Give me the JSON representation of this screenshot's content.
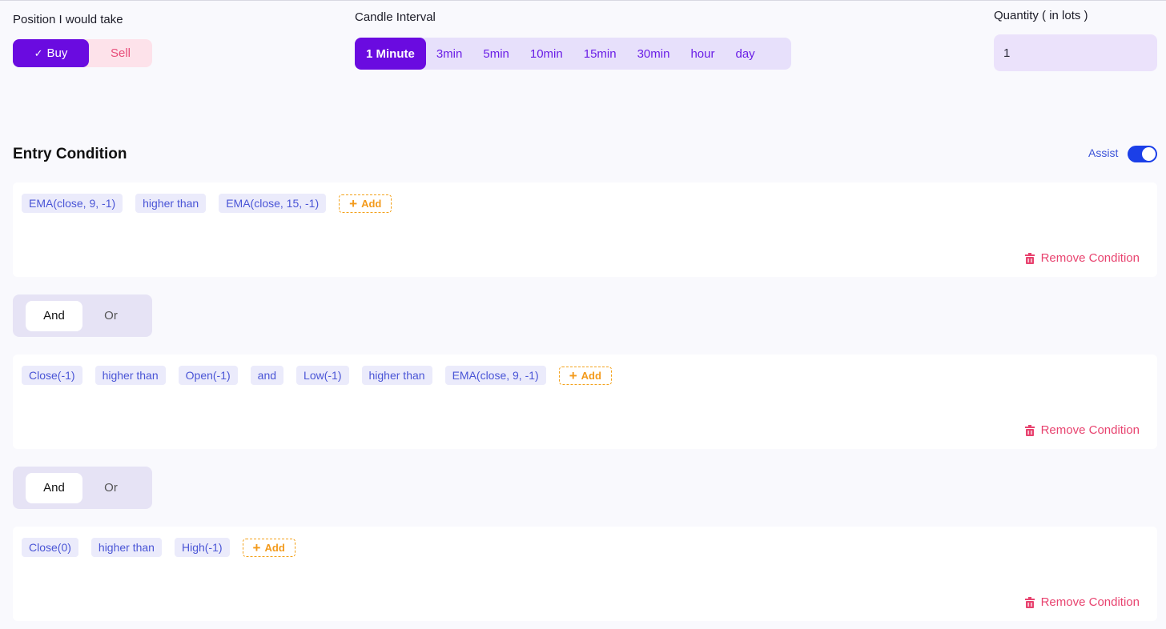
{
  "position": {
    "label": "Position I would take",
    "buy_label": "Buy",
    "sell_label": "Sell",
    "selected": "Buy"
  },
  "candle_interval": {
    "label": "Candle Interval",
    "options": [
      "1 Minute",
      "3min",
      "5min",
      "10min",
      "15min",
      "30min",
      "hour",
      "day"
    ],
    "selected": "1 Minute"
  },
  "quantity": {
    "label": "Quantity ( in lots )",
    "value": "1"
  },
  "entry_condition": {
    "title": "Entry Condition",
    "assist_label": "Assist",
    "assist_on": true,
    "add_label": "Add",
    "remove_label": "Remove Condition",
    "and_label": "And",
    "or_label": "Or",
    "conditions": [
      {
        "chips": [
          "EMA(close, 9, -1)",
          "higher than",
          "EMA(close, 15, -1)"
        ]
      },
      {
        "chips": [
          "Close(-1)",
          "higher than",
          "Open(-1)",
          "and",
          "Low(-1)",
          "higher than",
          "EMA(close, 9, -1)"
        ]
      },
      {
        "chips": [
          "Close(0)",
          "higher than",
          "High(-1)"
        ]
      }
    ],
    "joiners": [
      "And",
      "And"
    ]
  },
  "colors": {
    "primary": "#6a0be0",
    "chip_text": "#4a55d6",
    "add": "#f39a1b",
    "remove": "#e8436f",
    "switch": "#1b3fe8"
  }
}
